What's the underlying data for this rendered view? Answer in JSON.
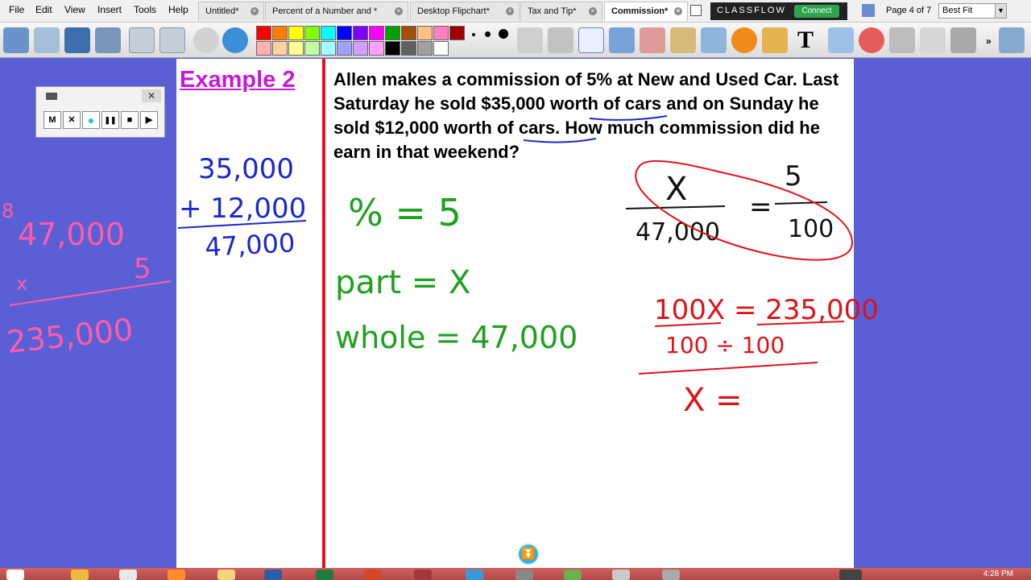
{
  "menu": [
    "File",
    "Edit",
    "View",
    "Insert",
    "Tools",
    "Help"
  ],
  "tabs": [
    {
      "label": "Untitled*"
    },
    {
      "label": "Percent of a Number and *"
    },
    {
      "label": "Desktop Flipchart*"
    },
    {
      "label": "Tax and Tip*"
    },
    {
      "label": "Commission*"
    }
  ],
  "classflow": {
    "logo": "CLASSFLOW",
    "connect": "Connect"
  },
  "page": {
    "label": "Page 4 of 7",
    "zoom": "Best Fit"
  },
  "colors": {
    "palette_top": [
      "#ff0000",
      "#ff8000",
      "#ffff00",
      "#80ff00",
      "#00ffff",
      "#0000ff",
      "#8000ff",
      "#ff00ff",
      "#00a000",
      "#a05000",
      "#ffc080",
      "#ff80c0",
      "#a00000"
    ],
    "palette_bottom": [
      "#ffb0b0",
      "#ffd0a0",
      "#ffff90",
      "#c0ffa0",
      "#a0ffff",
      "#a0a0ff",
      "#d0a0ff",
      "#ffa0ff",
      "#000000",
      "#606060",
      "#a0a0a0",
      "#ffffff"
    ],
    "canvas_bg": "#5a5fd6",
    "title_color": "#c61bd6"
  },
  "recorder": {
    "buttons": [
      "M",
      "✕",
      "●",
      "❚❚",
      "■",
      "▶"
    ]
  },
  "content": {
    "example_title": "Example 2",
    "problem": "Allen makes a commission of 5%  at New and Used Car. Last Saturday he sold $35,000 worth of cars and on Sunday he sold $12,000 worth of cars. How much commission did he earn in that weekend?"
  },
  "handwriting": {
    "sum_a": "35,000",
    "sum_b": "+ 12,000",
    "sum_total": "47,000",
    "left_a": "47,000",
    "left_times": "x",
    "left_b": "5",
    "left_result": "235,000",
    "left_mark": "8",
    "percent_eq": "%  =  5",
    "part_eq": "part  =  X",
    "whole_eq": "whole  =  47,000",
    "frac_num": "X",
    "frac_den": "47,000",
    "equals": "=",
    "frac2_num": "5",
    "frac2_den": "100",
    "cross": "100X  =  235,000",
    "cross_div": "100  ÷  100",
    "result": "X  ="
  },
  "taskbar": {
    "clock": "4:28 PM"
  }
}
